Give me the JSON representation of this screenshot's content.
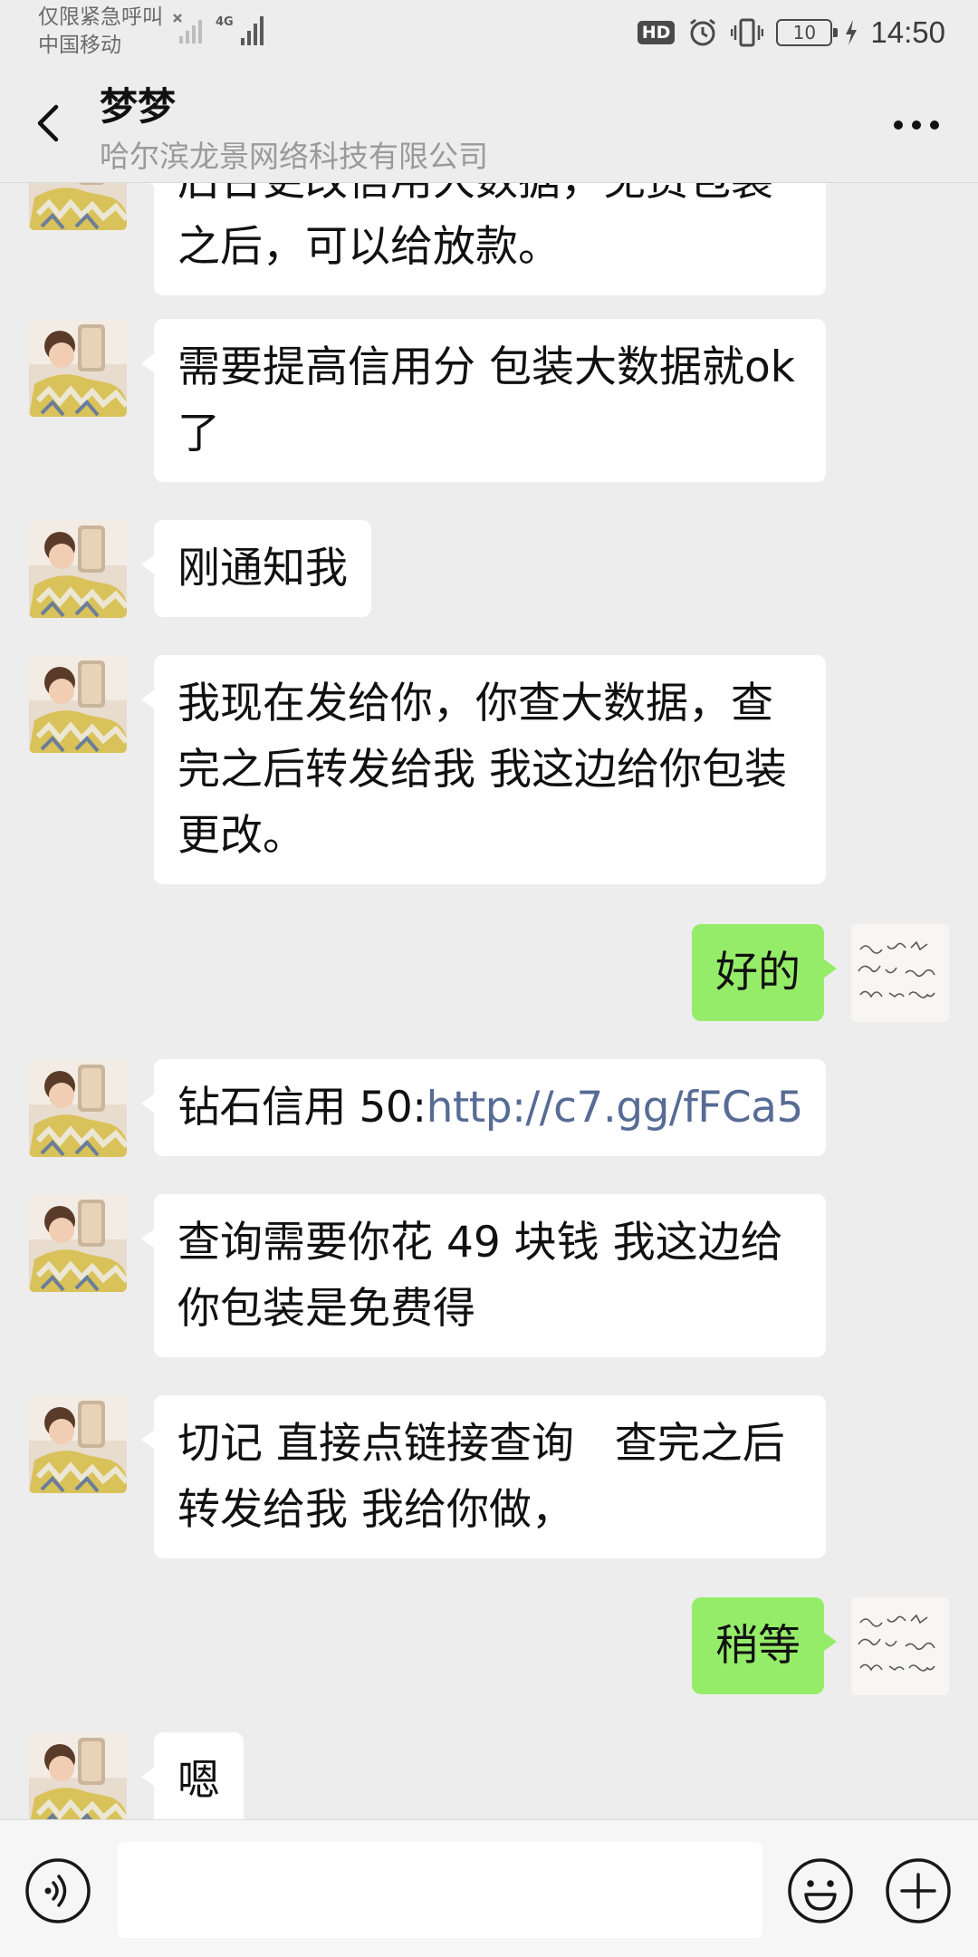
{
  "status_bar": {
    "line1": "仅限紧急呼叫",
    "line2": "中国移动",
    "network": "4G",
    "hd": "HD",
    "battery": "10",
    "time": "14:50"
  },
  "header": {
    "title": "梦梦",
    "subtitle": "哈尔滨龙景网络科技有限公司"
  },
  "messages": [
    {
      "side": "in",
      "text": "后台更改信用大数据，免费包装之后，可以给放款。"
    },
    {
      "side": "in",
      "text": "需要提高信用分 包装大数据就ok 了"
    },
    {
      "side": "in",
      "text": "刚通知我"
    },
    {
      "side": "in",
      "text": "我现在发给你，你查大数据，查完之后转发给我 我这边给你包装更改。"
    },
    {
      "side": "out",
      "text": "好的"
    },
    {
      "side": "in",
      "prefix": "钻石信用 50:",
      "link": "http://c7.gg/fFCa5"
    },
    {
      "side": "in",
      "text": "查询需要你花 49 块钱 我这边给你包装是免费得"
    },
    {
      "side": "in",
      "text": "切记 直接点链接查询   查完之后转发给我 我给你做，"
    },
    {
      "side": "out",
      "text": "稍等"
    },
    {
      "side": "in",
      "text": "嗯"
    }
  ],
  "input": {
    "value": "",
    "placeholder": ""
  },
  "colors": {
    "background": "#ededed",
    "bubble_in": "#ffffff",
    "bubble_out": "#95ec69",
    "link": "#576b95"
  },
  "icons": {
    "back": "chevron-left-icon",
    "more": "more-dots-icon",
    "voice": "voice-icon",
    "emoji": "emoji-icon",
    "plus": "plus-icon"
  }
}
